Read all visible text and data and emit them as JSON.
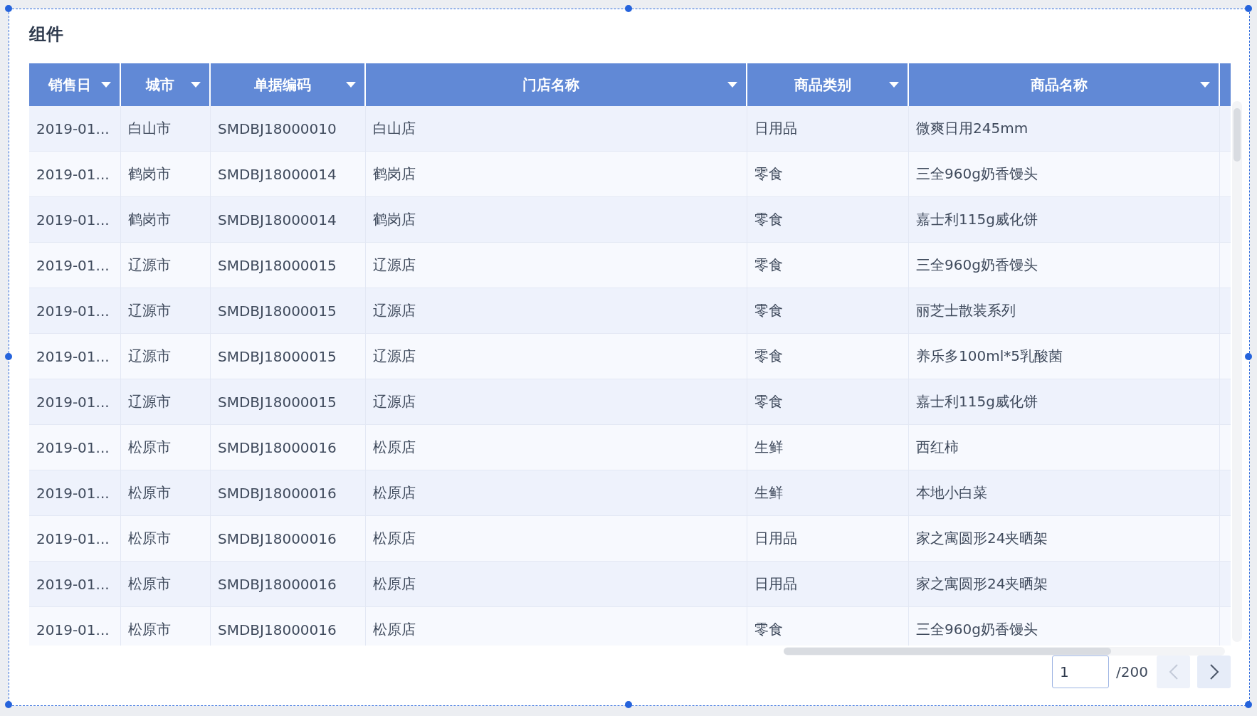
{
  "title": "组件",
  "table": {
    "columns": [
      {
        "label": "销售日"
      },
      {
        "label": "城市"
      },
      {
        "label": "单据编码"
      },
      {
        "label": "门店名称"
      },
      {
        "label": "商品类别"
      },
      {
        "label": "商品名称"
      }
    ],
    "rows": [
      [
        "2019-01...",
        "白山市",
        "SMDBJ18000010",
        "白山店",
        "日用品",
        "微爽日用245mm"
      ],
      [
        "2019-01...",
        "鹤岗市",
        "SMDBJ18000014",
        "鹤岗店",
        "零食",
        "三全960g奶香馒头"
      ],
      [
        "2019-01...",
        "鹤岗市",
        "SMDBJ18000014",
        "鹤岗店",
        "零食",
        "嘉士利115g威化饼"
      ],
      [
        "2019-01...",
        "辽源市",
        "SMDBJ18000015",
        "辽源店",
        "零食",
        "三全960g奶香馒头"
      ],
      [
        "2019-01...",
        "辽源市",
        "SMDBJ18000015",
        "辽源店",
        "零食",
        "丽芝士散装系列"
      ],
      [
        "2019-01...",
        "辽源市",
        "SMDBJ18000015",
        "辽源店",
        "零食",
        "养乐多100ml*5乳酸菌"
      ],
      [
        "2019-01...",
        "辽源市",
        "SMDBJ18000015",
        "辽源店",
        "零食",
        "嘉士利115g威化饼"
      ],
      [
        "2019-01...",
        "松原市",
        "SMDBJ18000016",
        "松原店",
        "生鲜",
        "西红柿"
      ],
      [
        "2019-01...",
        "松原市",
        "SMDBJ18000016",
        "松原店",
        "生鲜",
        "本地小白菜"
      ],
      [
        "2019-01...",
        "松原市",
        "SMDBJ18000016",
        "松原店",
        "日用品",
        "家之寓圆形24夹晒架"
      ],
      [
        "2019-01...",
        "松原市",
        "SMDBJ18000016",
        "松原店",
        "日用品",
        "家之寓圆形24夹晒架"
      ],
      [
        "2019-01...",
        "松原市",
        "SMDBJ18000016",
        "松原店",
        "零食",
        "三全960g奶香馒头"
      ]
    ]
  },
  "pagination": {
    "page": "1",
    "total": "/200",
    "prev": {
      "disabled": true
    },
    "next": {
      "disabled": false
    }
  }
}
